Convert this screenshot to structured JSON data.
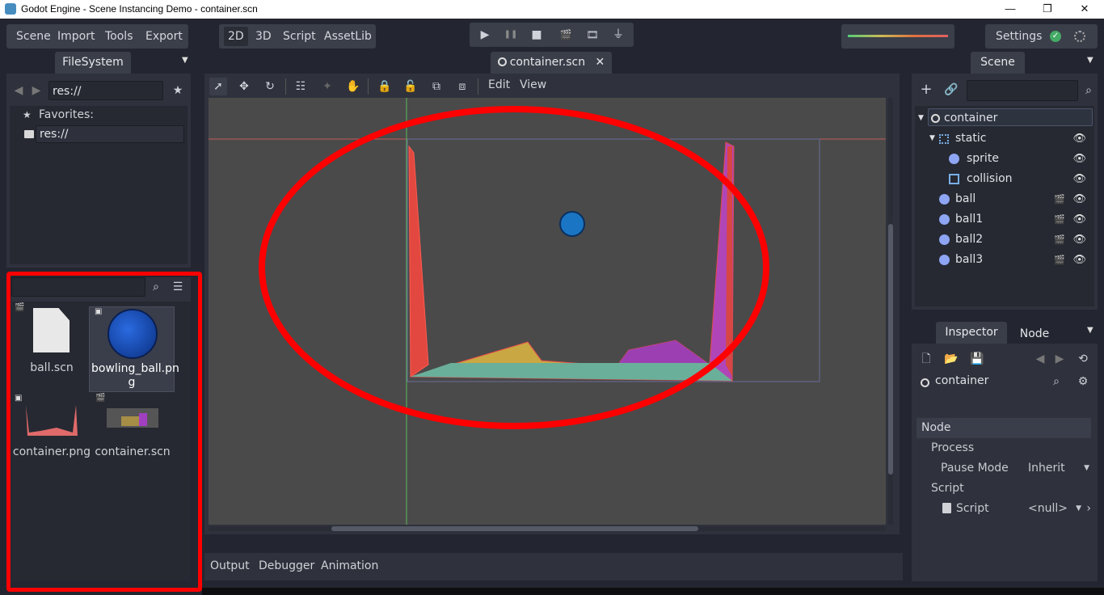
{
  "window": {
    "title": "Godot Engine - Scene Instancing Demo - container.scn",
    "minimize": "—",
    "restore": "❐",
    "close": "✕"
  },
  "menu": {
    "items": [
      "Scene",
      "Import",
      "Tools",
      "Export"
    ]
  },
  "workspaces": [
    "2D",
    "3D",
    "Script",
    "AssetLib"
  ],
  "playbar": {
    "play": "▶",
    "pause": "❚❚",
    "stop": "■",
    "play_scene": "🎬",
    "play_custom": "🎞",
    "deploy": "⏚"
  },
  "settings": {
    "label": "Settings"
  },
  "filesystem": {
    "tab": "FileSystem",
    "path": "res://",
    "favorites_label": "Favorites:",
    "favorite_item": "res://",
    "files": [
      {
        "name": "ball.scn",
        "kind": "scene"
      },
      {
        "name": "bowling_ball.pn\ng",
        "kind": "image"
      },
      {
        "name": "container.png",
        "kind": "image"
      },
      {
        "name": "container.scn",
        "kind": "scene"
      }
    ]
  },
  "editor_tab": {
    "label": "container.scn",
    "close": "✕"
  },
  "canvas_toolbar": {
    "edit": "Edit",
    "view": "View"
  },
  "bottom_panel": {
    "tabs": [
      "Output",
      "Debugger",
      "Animation"
    ]
  },
  "scene_dock": {
    "tab": "Scene",
    "nodes": [
      {
        "name": "container",
        "depth": 0,
        "icon": "node-icon"
      },
      {
        "name": "static",
        "depth": 1,
        "icon": "static-body-icon"
      },
      {
        "name": "sprite",
        "depth": 2,
        "icon": "sprite-icon"
      },
      {
        "name": "collision",
        "depth": 2,
        "icon": "collision-polygon-icon"
      },
      {
        "name": "ball",
        "depth": 1,
        "icon": "rigid-body-icon"
      },
      {
        "name": "ball1",
        "depth": 1,
        "icon": "rigid-body-icon"
      },
      {
        "name": "ball2",
        "depth": 1,
        "icon": "rigid-body-icon"
      },
      {
        "name": "ball3",
        "depth": 1,
        "icon": "rigid-body-icon"
      }
    ]
  },
  "inspector": {
    "tabs": [
      "Inspector",
      "Node"
    ],
    "object_name": "container",
    "section": "Node",
    "groups": [
      {
        "label": "Process"
      },
      {
        "label": "Script"
      }
    ],
    "pause_mode_label": "Pause Mode",
    "pause_mode_value": "Inherit",
    "script_label": "Script",
    "script_value": "<null>"
  },
  "colors": {
    "accent_red": "#ff0000",
    "bg_dark": "#232630",
    "panel": "#2f323c",
    "viewport": "#4a4a4a"
  }
}
